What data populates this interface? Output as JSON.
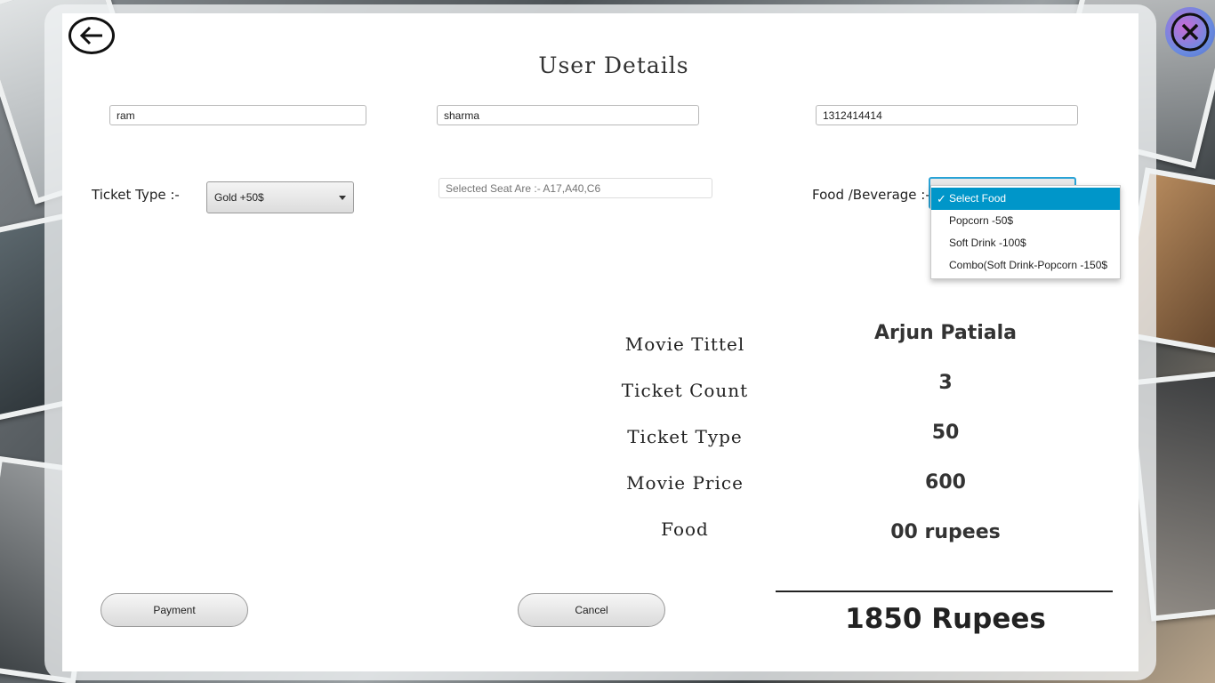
{
  "page": {
    "title": "User Details"
  },
  "inputs": {
    "first_name": "ram",
    "last_name": "sharma",
    "phone": "1312414414",
    "seats_placeholder": "Selected Seat Are :- A17,A40,C6"
  },
  "ticket_type": {
    "label": "Ticket Type  :-",
    "selected": "Gold  +50$"
  },
  "food": {
    "label": "Food /Beverage :-",
    "options": [
      "Select Food",
      "Popcorn -50$",
      "Soft Drink -100$",
      "Combo(Soft Drink-Popcorn -150$"
    ],
    "selected_index": 0
  },
  "summary": {
    "movie_title_label": "Movie Tittel",
    "movie_title_value": "Arjun Patiala",
    "ticket_count_label": "Ticket Count",
    "ticket_count_value": "3",
    "ticket_type_label": "Ticket Type",
    "ticket_type_value": "50",
    "movie_price_label": "Movie Price",
    "movie_price_value": "600",
    "food_label": "Food",
    "food_value": "00 rupees"
  },
  "buttons": {
    "payment": "Payment",
    "cancel": "Cancel"
  },
  "total": "1850 Rupees",
  "icons": {
    "back": "back-arrow-icon",
    "close": "close-icon"
  },
  "colors": {
    "accent": "#0096c9",
    "close_gradient": "#6a8be0"
  }
}
